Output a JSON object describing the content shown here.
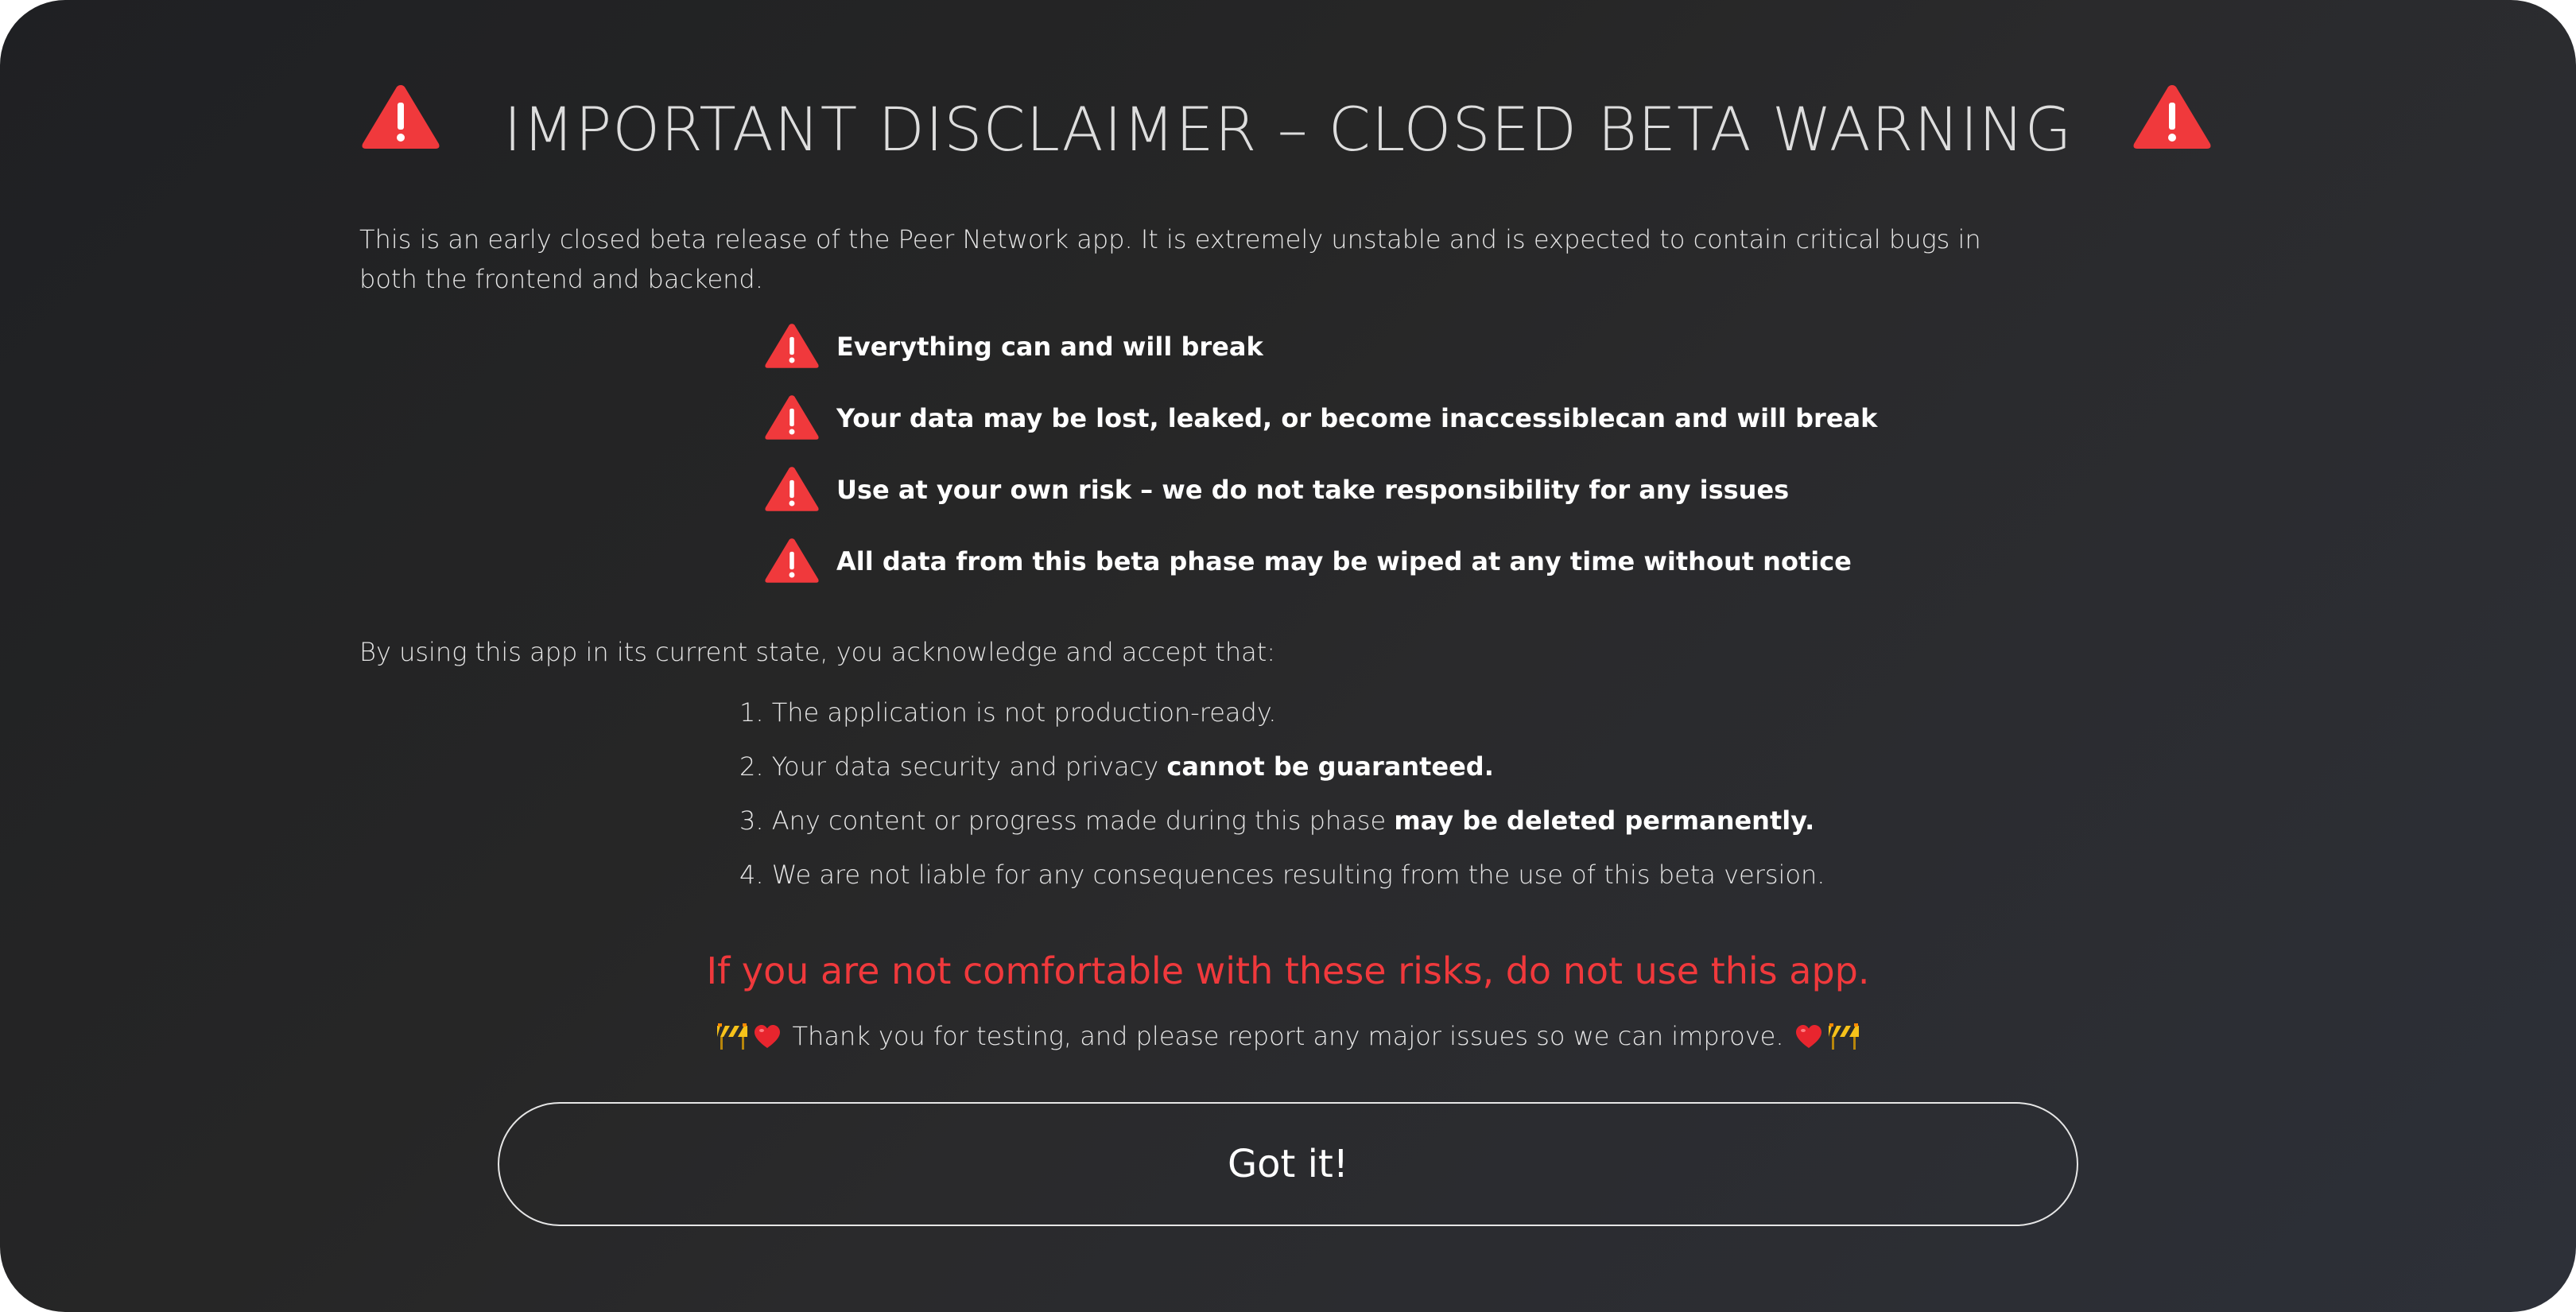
{
  "dialog": {
    "title": "IMPORTANT DISCLAIMER – CLOSED BETA WARNING",
    "intro": "This is an early closed beta release of the Peer Network app. It is extremely unstable and is expected to contain critical bugs in both the frontend and backend.",
    "warnings": [
      "Everything can and will break",
      "Your data may be lost, leaked, or become inaccessiblecan and will break",
      " Use at your own risk – we do not take responsibility for any issues",
      "All data from this beta phase may be wiped at any time without notice"
    ],
    "acceptance_intro": "By using this app in its current state, you acknowledge and accept that:",
    "acceptance_items": [
      {
        "number": "1.",
        "text": "The application is not production-ready.",
        "bold": ""
      },
      {
        "number": "2.",
        "text": "Your data security and privacy ",
        "bold": "cannot be guaranteed."
      },
      {
        "number": "3.",
        "text": "Any content or progress made during this phase ",
        "bold": "may be deleted permanently."
      },
      {
        "number": "4.",
        "text": "We are not liable for any consequences resulting from the use of this beta version.",
        "bold": ""
      }
    ],
    "risk_notice": "If you are not comfortable with these risks, do not use this app.",
    "thanks": "Thank you for testing, and please report any major issues so we can improve.",
    "confirm_button": "Got it!"
  },
  "icons": {
    "warning": "warning-triangle-icon",
    "construction": "construction-barrier-icon",
    "heart": "heart-icon"
  },
  "colors": {
    "warning": "#f0393c",
    "text": "#e6e6e6",
    "title": "#dddddd"
  }
}
